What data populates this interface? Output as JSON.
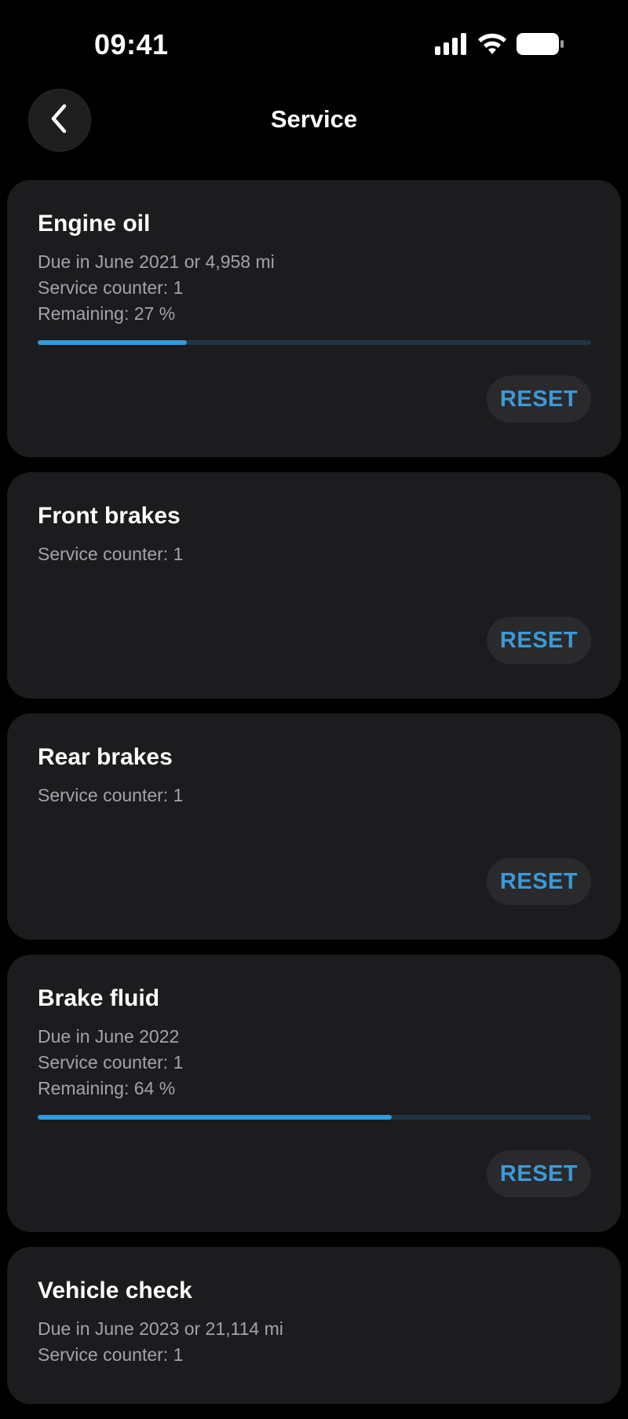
{
  "status_bar": {
    "time": "09:41",
    "icons": [
      "cellular-signal-icon",
      "wifi-icon",
      "battery-icon"
    ]
  },
  "nav": {
    "back_icon": "chevron-left-icon",
    "title": "Service"
  },
  "colors": {
    "background": "#000000",
    "card": "#1c1c1e",
    "accent": "#2f9be0",
    "track": "#1f3447",
    "secondary_text": "#a3a3a8"
  },
  "services": [
    {
      "title": "Engine oil",
      "due": "Due in June 2021 or 4,958 mi",
      "counter": "Service counter: 1",
      "remaining": "Remaining: 27 %",
      "progress": 0.27,
      "reset_label": "RESET"
    },
    {
      "title": "Front brakes",
      "counter": "Service counter: 1",
      "reset_label": "RESET"
    },
    {
      "title": "Rear brakes",
      "counter": "Service counter: 1",
      "reset_label": "RESET"
    },
    {
      "title": "Brake fluid",
      "due": "Due in June 2022",
      "counter": "Service counter: 1",
      "remaining": "Remaining: 64 %",
      "progress": 0.64,
      "reset_label": "RESET"
    },
    {
      "title": "Vehicle check",
      "due": "Due in June 2023 or 21,114 mi",
      "counter": "Service counter: 1"
    }
  ]
}
